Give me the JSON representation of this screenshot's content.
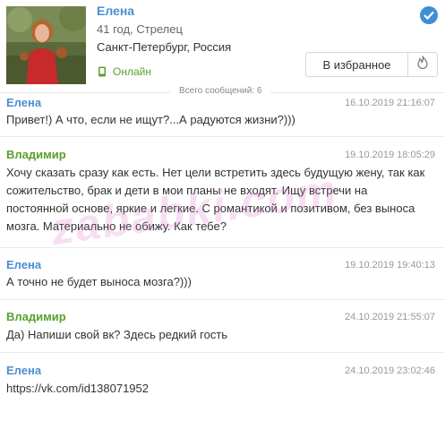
{
  "profile": {
    "name": "Елена",
    "age_city": "41 год, Стрелец",
    "location": "Санкт-Петербург, Россия",
    "status": "Онлайн",
    "verified_icon": "checkmark-circle-icon"
  },
  "actions": {
    "favorite_label": "В избранное",
    "fire_icon": "fire-icon"
  },
  "total_label": "Всего сообщений: 6",
  "colors": {
    "accent": "#4a8fd0",
    "male_author": "#5aa02c",
    "female_author": "#4a8fd0"
  },
  "messages": [
    {
      "author": "Елена",
      "date": "16.10.2019 21:16:07",
      "text": "Привет!) А что, если не ищут?...А радуются жизни?)))"
    },
    {
      "author": "Владимир",
      "date": "19.10.2019 18:05:29",
      "text": "Хочу сказать сразу как есть. Нет цели встретить здесь будущую жену, так как сожительство, брак и дети в мои планы не входят. Ищу встречи на постоянной основе, яркие и легкие. С романтикой и позитивом, без выноса мозга. Материально не обижу. Как тебе?"
    },
    {
      "author": "Елена",
      "date": "19.10.2019 19:40:13",
      "text": "А точно не будет выноса мозга?)))"
    },
    {
      "author": "Владимир",
      "date": "24.10.2019 21:55:07",
      "text": "Да) Напиши свой вк? Здесь редкий гость"
    },
    {
      "author": "Елена",
      "date": "24.10.2019 23:02:46",
      "text": "https://vk.com/id138071952"
    }
  ],
  "watermark": "zababki.com"
}
